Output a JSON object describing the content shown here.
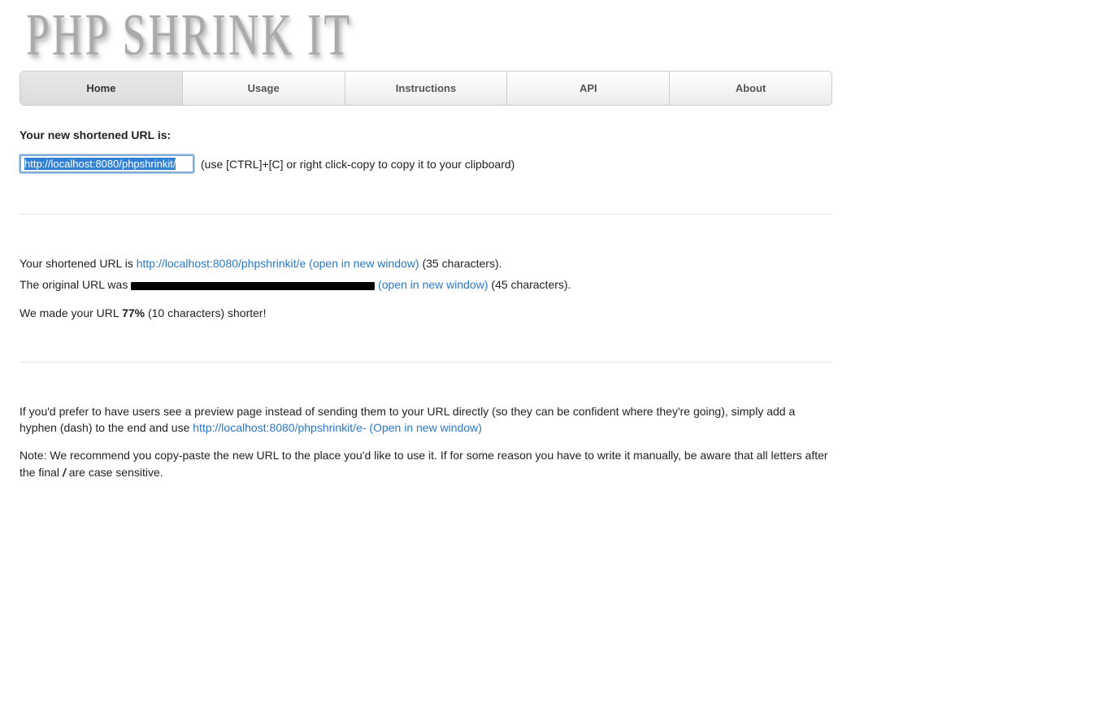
{
  "logo": "PHP SHRINK IT",
  "nav": {
    "home": "Home",
    "usage": "Usage",
    "instructions": "Instructions",
    "api": "API",
    "about": "About"
  },
  "heading": "Your new shortened URL is:",
  "url_input_value": "http://localhost:8080/phpshrinkit/",
  "copy_hint": "(use [CTRL]+[C] or right click-copy to copy it to your clipboard)",
  "short": {
    "prefix": "Your shortened URL is ",
    "link": "http://localhost:8080/phpshrinkit/e (open in new window)",
    "suffix": " (35 characters)."
  },
  "orig": {
    "prefix": "The original URL was ",
    "link": " (open in new window)",
    "suffix": " (45 characters)."
  },
  "savings": {
    "prefix": "We made your URL ",
    "percent": "77%",
    "suffix": " (10 characters) shorter!"
  },
  "preview": {
    "prefix": "If you'd prefer to have users see a preview page instead of sending them to your URL directly (so they can be confident where they're going), simply add a hyphen (dash) to the end and use ",
    "link": "http://localhost:8080/phpshrinkit/e- (Open in new window)"
  },
  "note": {
    "p1": "Note: We recommend you copy-paste the new URL to the place you'd like to use it. If for some reason you have to write it manually, be aware that all letters after the final ",
    "slash": "/",
    "p2": " are case sensitive."
  }
}
